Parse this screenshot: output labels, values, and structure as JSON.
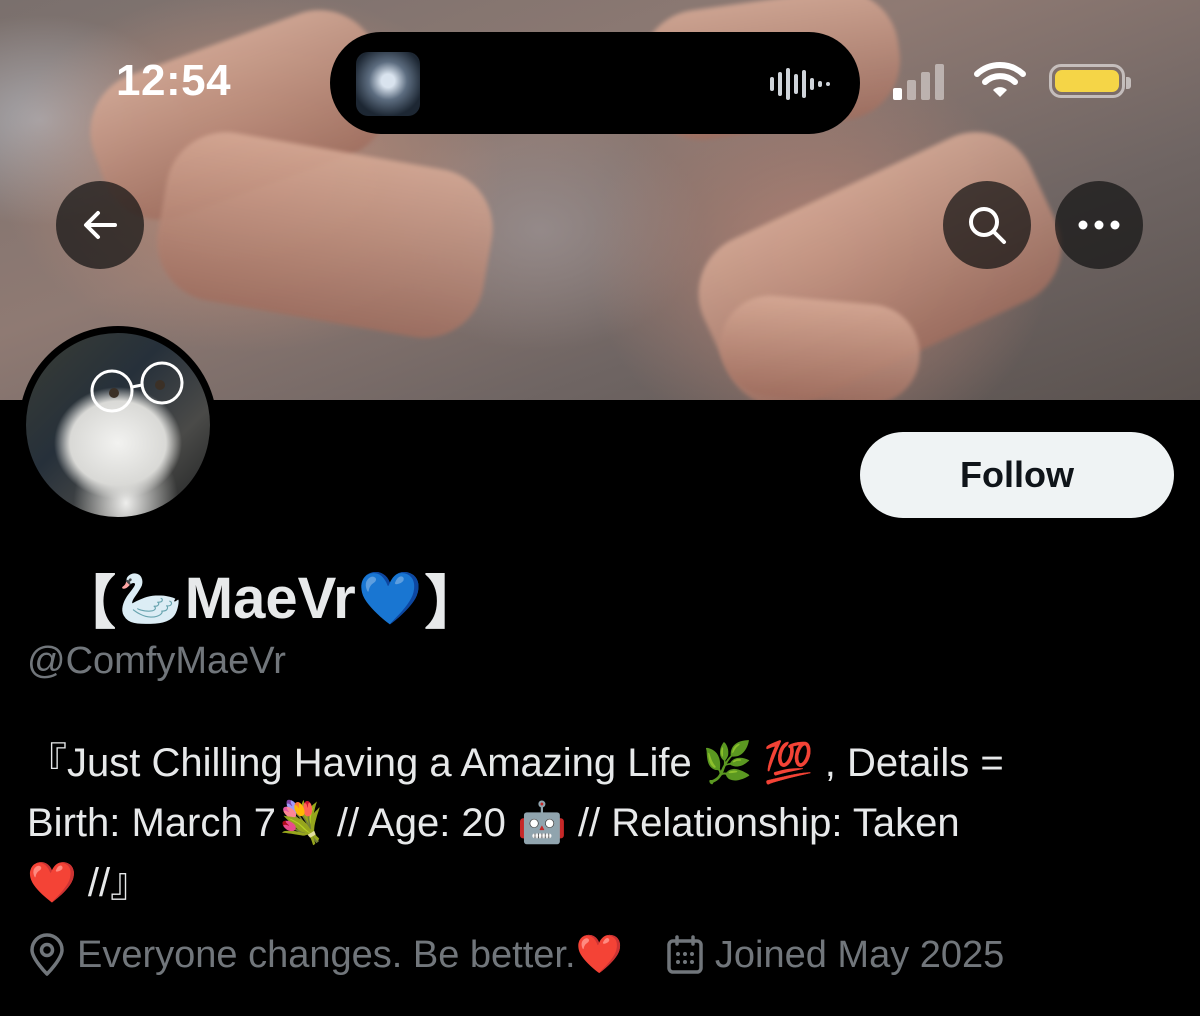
{
  "status_bar": {
    "time": "12:54",
    "battery_level": 1.0,
    "colors": {
      "battery_fill": "#f5d547"
    }
  },
  "header": {
    "back_icon": "arrow-left-icon",
    "search_icon": "search-icon",
    "more_icon": "more-horizontal-icon"
  },
  "profile": {
    "name_open": "【",
    "name_emoji_swan": "🦢",
    "name_text": "MaeVr",
    "name_emoji_heart": "💙",
    "name_close": "】",
    "handle": "@ComfyMaeVr",
    "follow_label": "Follow",
    "bio_line1": "『Just Chilling Having a Amazing Life 🌿 💯 , Details =",
    "bio_line2": "Birth: March 7💐  // Age: 20  🤖 // Relationship: Taken",
    "bio_line3": "❤️ //』",
    "location": "Everyone changes. Be better.❤️",
    "joined": "Joined May 2025",
    "location_icon": "location-pin-icon",
    "joined_icon": "calendar-icon"
  },
  "colors": {
    "background": "#000000",
    "primary_text": "#e7e9ea",
    "secondary_text": "#71767b",
    "follow_button_bg": "#eff3f4"
  }
}
